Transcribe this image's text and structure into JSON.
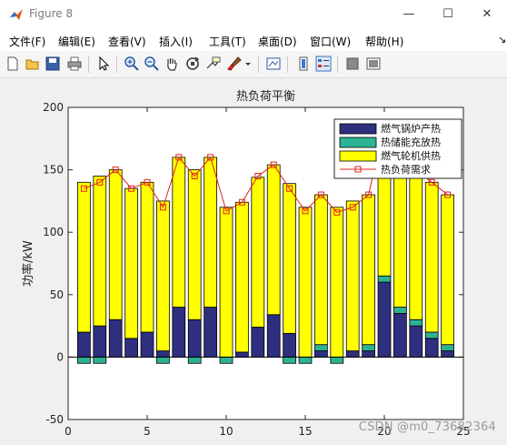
{
  "window": {
    "title": "Figure 8",
    "minimize_glyph": "—",
    "maximize_glyph": "☐",
    "close_glyph": "✕"
  },
  "menu": [
    {
      "label": "文件(F)"
    },
    {
      "label": "编辑(E)"
    },
    {
      "label": "查看(V)"
    },
    {
      "label": "插入(I)"
    },
    {
      "label": "工具(T)"
    },
    {
      "label": "桌面(D)"
    },
    {
      "label": "窗口(W)"
    },
    {
      "label": "帮助(H)"
    }
  ],
  "toolbar": [
    {
      "icon": "new-figure-icon"
    },
    {
      "icon": "open-file-icon"
    },
    {
      "icon": "save-icon"
    },
    {
      "icon": "print-icon"
    },
    {
      "icon": "edit-plot-arrow-icon"
    },
    {
      "icon": "zoom-in-icon"
    },
    {
      "icon": "zoom-out-icon"
    },
    {
      "icon": "pan-hand-icon"
    },
    {
      "icon": "rotate-3d-icon"
    },
    {
      "icon": "data-cursor-icon"
    },
    {
      "icon": "brush-icon"
    },
    {
      "icon": "link-plot-icon"
    },
    {
      "icon": "colorbar-icon"
    },
    {
      "icon": "legend-icon"
    },
    {
      "icon": "hide-plot-tools-icon"
    },
    {
      "icon": "show-plot-tools-icon"
    }
  ],
  "watermark": "CSDN @m0_73682364",
  "colors": {
    "gas_boiler": "#2e2f7e",
    "storage": "#2db394",
    "gas_turbine": "#ffff00",
    "demand_line": "#e0221c"
  },
  "chart_data": {
    "type": "bar",
    "stacked": true,
    "title": "热负荷平衡",
    "xlabel": "",
    "ylabel": "功率/kW",
    "xlim": [
      0,
      25
    ],
    "ylim": [
      -50,
      200
    ],
    "xticks": [
      0,
      5,
      10,
      15,
      20,
      25
    ],
    "yticks": [
      -50,
      0,
      50,
      100,
      150,
      200
    ],
    "legend_position": "top-right",
    "x": [
      1,
      2,
      3,
      4,
      5,
      6,
      7,
      8,
      9,
      10,
      11,
      12,
      13,
      14,
      15,
      16,
      17,
      18,
      19,
      20,
      21,
      22,
      23,
      24
    ],
    "series": [
      {
        "name": "燃气锅炉产热",
        "kind": "bar",
        "values": [
          20,
          25,
          30,
          15,
          20,
          5,
          40,
          30,
          40,
          0,
          4,
          24,
          34,
          19,
          0,
          5,
          0,
          5,
          5,
          60,
          35,
          25,
          15,
          5
        ]
      },
      {
        "name": "热储能充放热",
        "kind": "bar",
        "values": [
          -5,
          -5,
          0,
          0,
          0,
          -5,
          0,
          -5,
          0,
          -5,
          0,
          0,
          0,
          -5,
          -5,
          5,
          -5,
          0,
          5,
          5,
          5,
          5,
          5,
          5
        ]
      },
      {
        "name": "燃气轮机供热",
        "kind": "bar",
        "values": [
          120,
          120,
          120,
          120,
          120,
          120,
          120,
          120,
          120,
          120,
          120,
          120,
          120,
          120,
          120,
          120,
          120,
          120,
          120,
          120,
          120,
          120,
          120,
          120
        ]
      },
      {
        "name": "热负荷需求",
        "kind": "line",
        "values": [
          135,
          140,
          150,
          135,
          140,
          120,
          160,
          145,
          160,
          117,
          124,
          145,
          154,
          135,
          117,
          130,
          116,
          120,
          130,
          185,
          160,
          150,
          140,
          130
        ]
      }
    ]
  }
}
